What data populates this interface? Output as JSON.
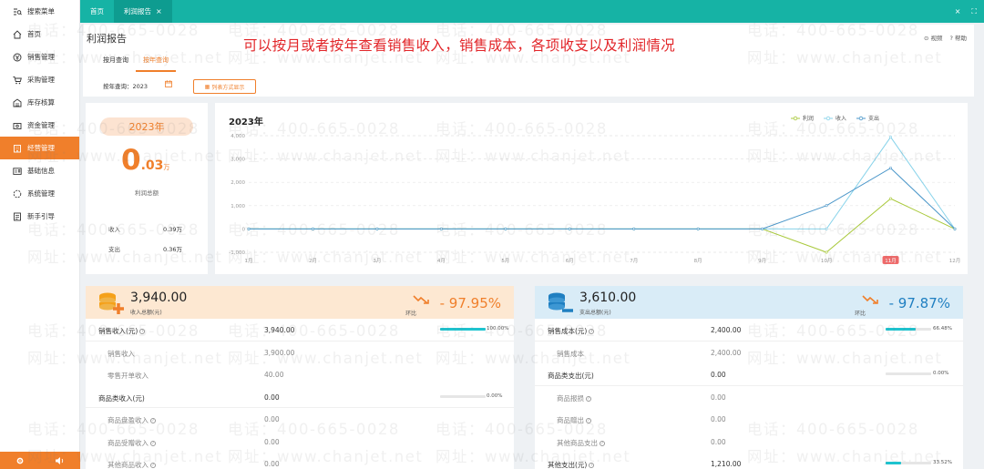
{
  "sidebar": {
    "search": "搜索菜单",
    "items": [
      {
        "label": "首页",
        "icon": "home-icon"
      },
      {
        "label": "销售管理",
        "icon": "sales-icon"
      },
      {
        "label": "采购管理",
        "icon": "cart-icon"
      },
      {
        "label": "库存核算",
        "icon": "warehouse-icon"
      },
      {
        "label": "资金管理",
        "icon": "wallet-icon"
      },
      {
        "label": "经营管理",
        "icon": "building-icon",
        "active": true
      },
      {
        "label": "基础信息",
        "icon": "id-card-icon"
      },
      {
        "label": "系统管理",
        "icon": "system-icon"
      },
      {
        "label": "新手引导",
        "icon": "guide-icon"
      }
    ]
  },
  "tabs": [
    {
      "label": "首页"
    },
    {
      "label": "利润报告",
      "close": "×"
    }
  ],
  "window": {
    "close": "×",
    "fullscreen": "⛶"
  },
  "header": {
    "title": "利润报告",
    "banner": "可以按月或者按年查看销售收入，销售成本，各项收支以及利润情况",
    "video": "视频",
    "help": "帮助",
    "subtabs": [
      "按月查询",
      "按年查询"
    ],
    "filter_label": "按年查询：",
    "filter_year": "2023",
    "list_button": "列表方式显示"
  },
  "profit": {
    "year": "2023年",
    "big_int": "0",
    "big_dec": ".03",
    "unit": "万",
    "label": "利润总额",
    "income_label": "收入",
    "income_value": "0.39万",
    "expense_label": "支出",
    "expense_value": "0.36万"
  },
  "chart_data": {
    "type": "line",
    "title": "2023年",
    "categories": [
      "1月",
      "2月",
      "3月",
      "4月",
      "5月",
      "6月",
      "7月",
      "8月",
      "9月",
      "10月",
      "11月",
      "12月"
    ],
    "y_ticks": [
      "4,000",
      "3,000",
      "2,000",
      "1,000",
      "0",
      "-1,000"
    ],
    "ylim": [
      -1000,
      4000
    ],
    "highlight_category": "11月",
    "legend_position": "top-right",
    "series": [
      {
        "name": "利润",
        "color": "#a9c93b",
        "values": [
          0,
          0,
          0,
          0,
          0,
          0,
          0,
          0,
          0,
          -1000,
          1300,
          0
        ]
      },
      {
        "name": "收入",
        "color": "#88d3ea",
        "values": [
          0,
          0,
          0,
          0,
          0,
          0,
          0,
          0,
          0,
          0,
          3940,
          0
        ]
      },
      {
        "name": "支出",
        "color": "#4a96c9",
        "values": [
          0,
          0,
          0,
          0,
          0,
          0,
          0,
          0,
          0,
          1000,
          2610,
          0
        ]
      }
    ]
  },
  "income": {
    "amount": "3,940.00",
    "sub": "收入总额(元)",
    "hb": "环比",
    "pct": "- 97.95%",
    "rows": [
      {
        "label": "销售收入(元)",
        "q": true,
        "value": "3,940.00",
        "bar": 1.0,
        "pct": "100.00%",
        "level": 0
      },
      {
        "label": "销售收入",
        "value": "3,900.00",
        "level": 1
      },
      {
        "label": "零售开单收入",
        "value": "40.00",
        "level": 1
      },
      {
        "label": "商品类收入(元)",
        "value": "0.00",
        "bar": 0.0,
        "pct": "0.00%",
        "level": 0
      },
      {
        "label": "商品盘盈收入",
        "q": true,
        "value": "0.00",
        "level": 1
      },
      {
        "label": "商品受赠收入",
        "q": true,
        "value": "0.00",
        "level": 1
      },
      {
        "label": "其他商品收入",
        "q": true,
        "value": "0.00",
        "level": 1
      }
    ]
  },
  "expense": {
    "amount": "3,610.00",
    "sub": "支出总额(元)",
    "hb": "环比",
    "pct": "- 97.87%",
    "rows": [
      {
        "label": "销售成本(元)",
        "q": true,
        "value": "2,400.00",
        "bar": 0.6648,
        "pct": "66.48%",
        "level": 0
      },
      {
        "label": "销售成本",
        "value": "2,400.00",
        "level": 1
      },
      {
        "label": "商品类支出(元)",
        "value": "0.00",
        "bar": 0.0,
        "pct": "0.00%",
        "level": 0
      },
      {
        "label": "商品报损",
        "q": true,
        "value": "0.00",
        "level": 1
      },
      {
        "label": "商品赠出",
        "q": true,
        "value": "0.00",
        "level": 1
      },
      {
        "label": "其他商品支出",
        "q": true,
        "value": "0.00",
        "level": 1
      },
      {
        "label": "其他支出(元)",
        "q": true,
        "value": "1,210.00",
        "bar": 0.3352,
        "pct": "33.52%",
        "level": 0
      }
    ]
  },
  "watermark": {
    "phone": "电话：400-665-0028",
    "site": "网址：www.chanjet.net"
  },
  "colors": {
    "accent": "#f07f2b",
    "teal": "#16b3a5",
    "bar": "#1ec3cf"
  }
}
